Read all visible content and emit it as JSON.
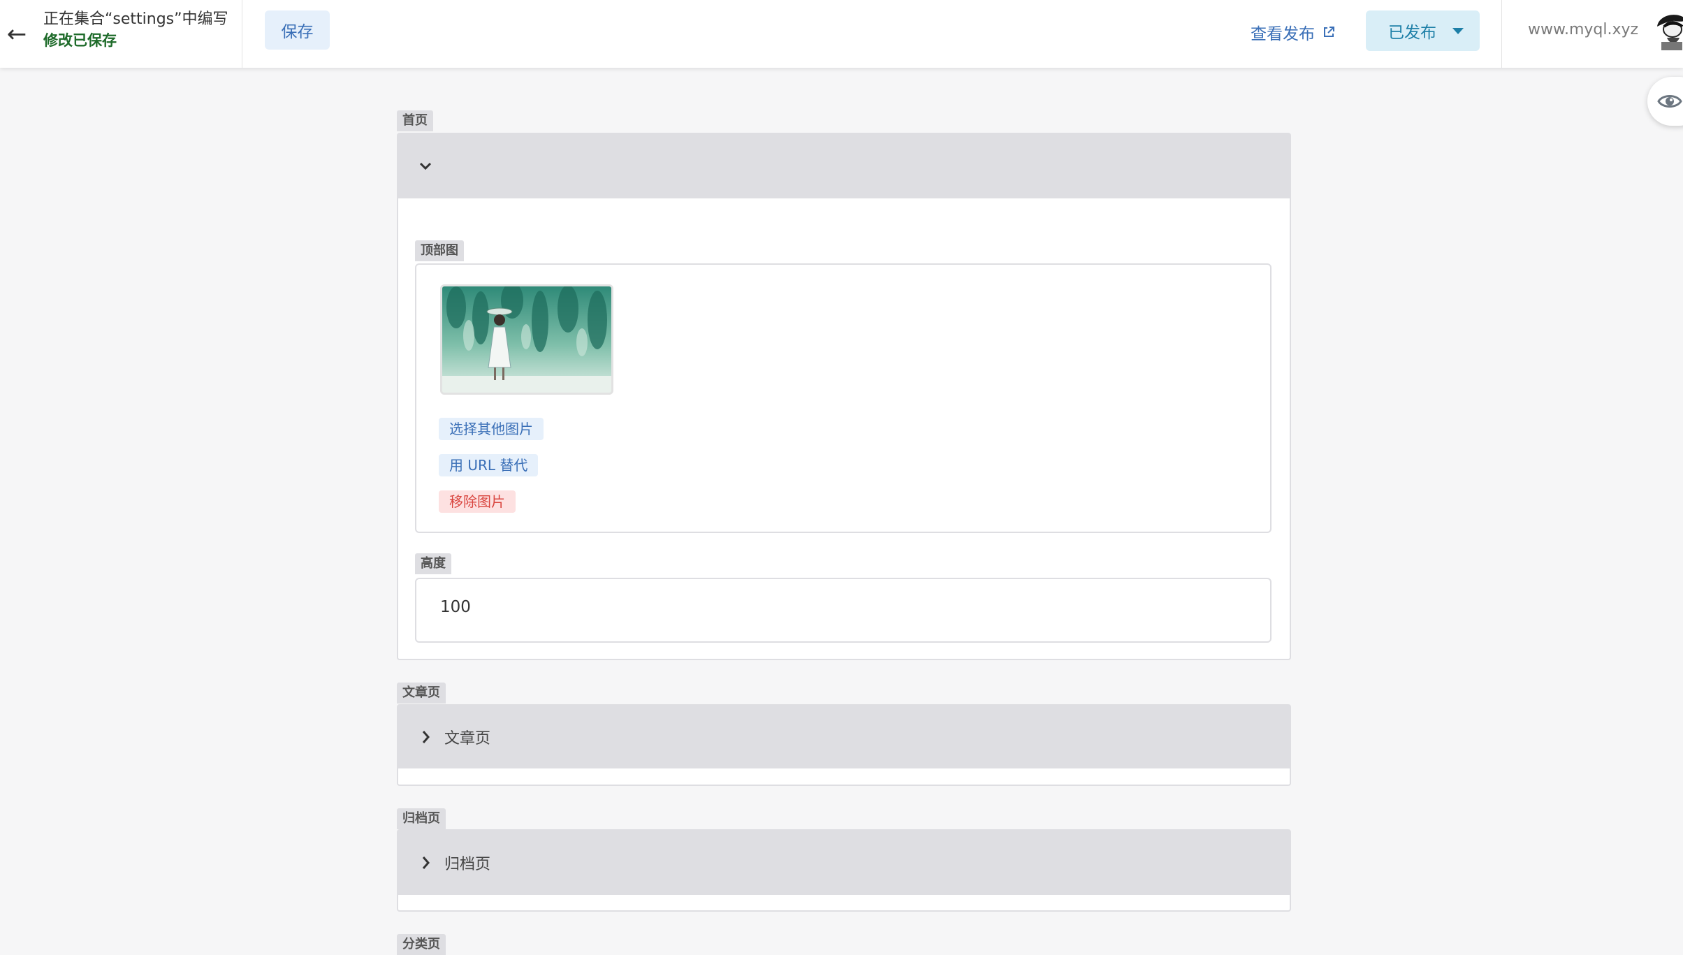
{
  "topbar": {
    "back_icon": "arrow-left-icon",
    "edit_title": "正在集合“settings”中编写",
    "edit_status": "修改已保存",
    "save_label": "保存",
    "view_published_label": "查看发布",
    "view_published_icon": "external-link-icon",
    "published_label": "已发布",
    "published_dropdown_icon": "caret-down-icon",
    "site_url": "www.myql.xyz",
    "colors": {
      "accent": "#3a6fb7",
      "status_green": "#1e6b2a",
      "published": "#1d7fa7"
    }
  },
  "preview_toggle_icon": "eye-icon",
  "sections": {
    "home": {
      "tag": "首页",
      "expanded": true,
      "toggle_icon": "chevron-down-icon",
      "banner": {
        "tag": "顶部图",
        "choose_label": "选择其他图片",
        "url_label": "用 URL 替代",
        "remove_label": "移除图片"
      },
      "height": {
        "tag": "高度",
        "value": "100"
      }
    },
    "article": {
      "tag": "文章页",
      "title": "文章页",
      "expanded": false,
      "toggle_icon": "chevron-right-icon"
    },
    "archive": {
      "tag": "归档页",
      "title": "归档页",
      "expanded": false,
      "toggle_icon": "chevron-right-icon"
    },
    "category": {
      "tag": "分类页"
    }
  }
}
